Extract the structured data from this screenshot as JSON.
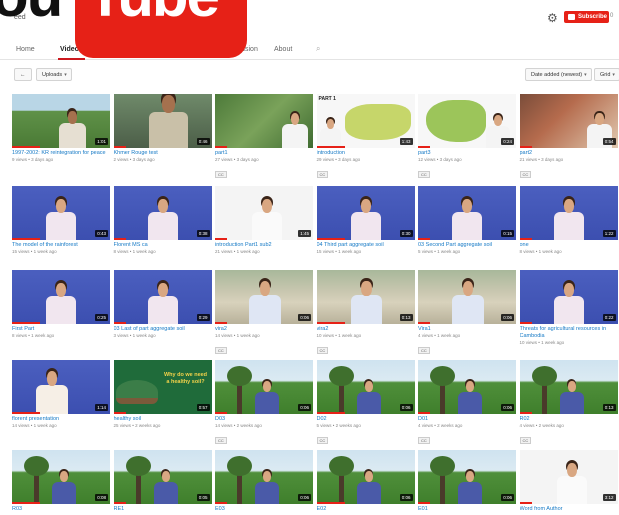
{
  "logo": {
    "left_text": "ou",
    "right_text": "Tube"
  },
  "channel": {
    "name": "eed"
  },
  "header": {
    "subscribe_label": "Subscribe",
    "subscriber_count": "0"
  },
  "tabs": [
    {
      "label": "Home",
      "active": false
    },
    {
      "label": "Videos",
      "active": true
    },
    {
      "label": "Discussion",
      "active": false
    },
    {
      "label": "About",
      "active": false
    }
  ],
  "toolbar": {
    "back_label": "←",
    "uploads_label": "Uploads",
    "sort_label": "Date added (newest)",
    "view_label": "Grid"
  },
  "videos": [
    {
      "title": "1997-2002: KR reintegration for peace",
      "meta": "9 views • 3 days ago",
      "duration": "1:01",
      "cc": false,
      "scene": "man-outdoor"
    },
    {
      "title": "Khmer Rouge test",
      "meta": "2 views • 3 days ago",
      "duration": "0:46",
      "cc": false,
      "scene": "man-close"
    },
    {
      "title": "part1",
      "meta": "27 views • 3 days ago",
      "duration": "",
      "cc": true,
      "scene": "map-presenter"
    },
    {
      "title": "introduction",
      "meta": "29 views • 3 days ago",
      "duration": "1:43",
      "cc": true,
      "scene": "map-part1"
    },
    {
      "title": "part3",
      "meta": "12 views • 3 days ago",
      "duration": "0:24",
      "cc": true,
      "scene": "map-green"
    },
    {
      "title": "part2",
      "meta": "21 views • 3 days ago",
      "duration": "0:54",
      "cc": true,
      "scene": "veg-presenter"
    },
    {
      "title": "The model of the rainforest",
      "meta": "15 views • 1 week ago",
      "duration": "0:43",
      "cc": false,
      "scene": "blue"
    },
    {
      "title": "Florent MS ca",
      "meta": "8 views • 1 week ago",
      "duration": "0:38",
      "cc": false,
      "scene": "blue"
    },
    {
      "title": "introduction Part1 sub2",
      "meta": "21 views • 1 week ago",
      "duration": "1:45",
      "cc": false,
      "scene": "white"
    },
    {
      "title": "04 Third part aggregate soil",
      "meta": "15 views • 1 week ago",
      "duration": "0:30",
      "cc": false,
      "scene": "blue"
    },
    {
      "title": "03 Second Part aggregate soil",
      "meta": "5 views • 1 week ago",
      "duration": "0:15",
      "cc": false,
      "scene": "blue"
    },
    {
      "title": "one",
      "meta": "8 views • 1 week ago",
      "duration": "1:22",
      "cc": false,
      "scene": "blue"
    },
    {
      "title": "First Part",
      "meta": "8 views • 1 week ago",
      "duration": "0:25",
      "cc": false,
      "scene": "blue"
    },
    {
      "title": "03 Last of part aggregate soil",
      "meta": "3 views • 1 week ago",
      "duration": "0:29",
      "cc": false,
      "scene": "blue"
    },
    {
      "title": "vira2",
      "meta": "14 views • 1 week ago",
      "duration": "0:06",
      "cc": true,
      "scene": "park"
    },
    {
      "title": "vira2",
      "meta": "10 views • 1 week ago",
      "duration": "0:13",
      "cc": true,
      "scene": "park"
    },
    {
      "title": "Vira1",
      "meta": "4 views • 1 week ago",
      "duration": "0:06",
      "cc": true,
      "scene": "park"
    },
    {
      "title": "Threats for agricultural resources in Cambodia",
      "meta": "10 views • 1 week ago",
      "duration": "0:22",
      "cc": false,
      "scene": "blue"
    },
    {
      "title": "florent presentation",
      "meta": "14 views • 1 week ago",
      "duration": "1:14",
      "cc": false,
      "scene": "blue-wide"
    },
    {
      "title": "healthy soil",
      "meta": "25 views • 2 weeks ago",
      "duration": "0:57",
      "cc": false,
      "scene": "green-soil"
    },
    {
      "title": "D03",
      "meta": "14 views • 2 weeks ago",
      "duration": "0:06",
      "cc": true,
      "scene": "field"
    },
    {
      "title": "D02",
      "meta": "5 views • 2 weeks ago",
      "duration": "0:06",
      "cc": true,
      "scene": "field"
    },
    {
      "title": "D01",
      "meta": "4 views • 2 weeks ago",
      "duration": "0:06",
      "cc": true,
      "scene": "field"
    },
    {
      "title": "R02",
      "meta": "4 views • 2 weeks ago",
      "duration": "0:13",
      "cc": true,
      "scene": "field"
    },
    {
      "title": "R03",
      "meta": "",
      "duration": "0:08",
      "cc": false,
      "scene": "field"
    },
    {
      "title": "RE1",
      "meta": "",
      "duration": "0:05",
      "cc": false,
      "scene": "field"
    },
    {
      "title": "E03",
      "meta": "",
      "duration": "0:06",
      "cc": false,
      "scene": "field"
    },
    {
      "title": "E02",
      "meta": "",
      "duration": "0:06",
      "cc": false,
      "scene": "field"
    },
    {
      "title": "E01",
      "meta": "",
      "duration": "0:06",
      "cc": false,
      "scene": "field"
    },
    {
      "title": "Word from Author",
      "meta": "",
      "duration": "3:12",
      "cc": false,
      "scene": "white"
    }
  ],
  "overlays": {
    "healthy_soil_text": "Why do we need a healthy soil?",
    "map_part_label": "PART 1"
  },
  "icons": {
    "gear": "gear-icon",
    "search": "search-icon",
    "caret": "chevron-down-icon"
  },
  "colors": {
    "brand_red": "#e62117",
    "link_blue": "#167ac6",
    "presenter_blue_bg": "#4b5fbf"
  }
}
